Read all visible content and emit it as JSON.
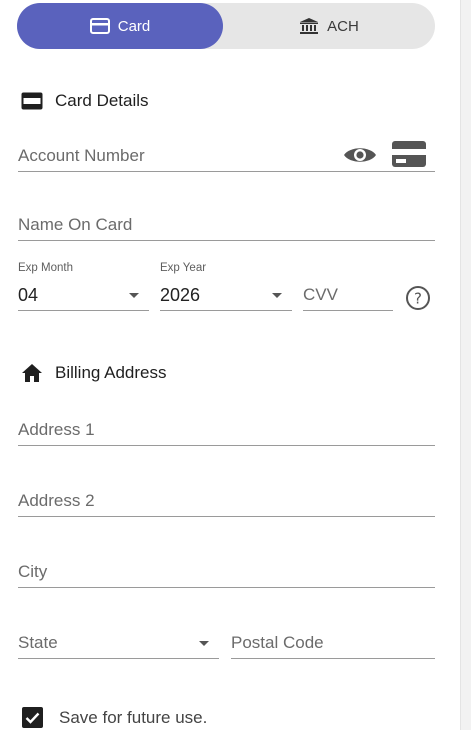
{
  "tabs": {
    "card_label": "Card",
    "ach_label": "ACH"
  },
  "card_details": {
    "title": "Card Details",
    "account_number_placeholder": "Account Number",
    "name_on_card_placeholder": "Name On Card",
    "exp_month_label": "Exp Month",
    "exp_month_value": "04",
    "exp_year_label": "Exp Year",
    "exp_year_value": "2026",
    "cvv_placeholder": "CVV"
  },
  "billing_address": {
    "title": "Billing Address",
    "address1_placeholder": "Address 1",
    "address2_placeholder": "Address 2",
    "city_placeholder": "City",
    "state_placeholder": "State",
    "postal_code_placeholder": "Postal Code"
  },
  "save": {
    "label": "Save for future use.",
    "checked": true
  },
  "icons": {
    "card_tab": "credit-card-icon",
    "ach_tab": "bank-icon",
    "card_details": "card-icon",
    "show_number": "eye-icon",
    "card_type": "card-brand-icon",
    "cvv_help": "help-circle-icon",
    "billing": "home-icon",
    "checkbox": "checkmark-icon"
  },
  "colors": {
    "accent": "#5a62bd",
    "toggle_bg": "#e6e6e6"
  }
}
